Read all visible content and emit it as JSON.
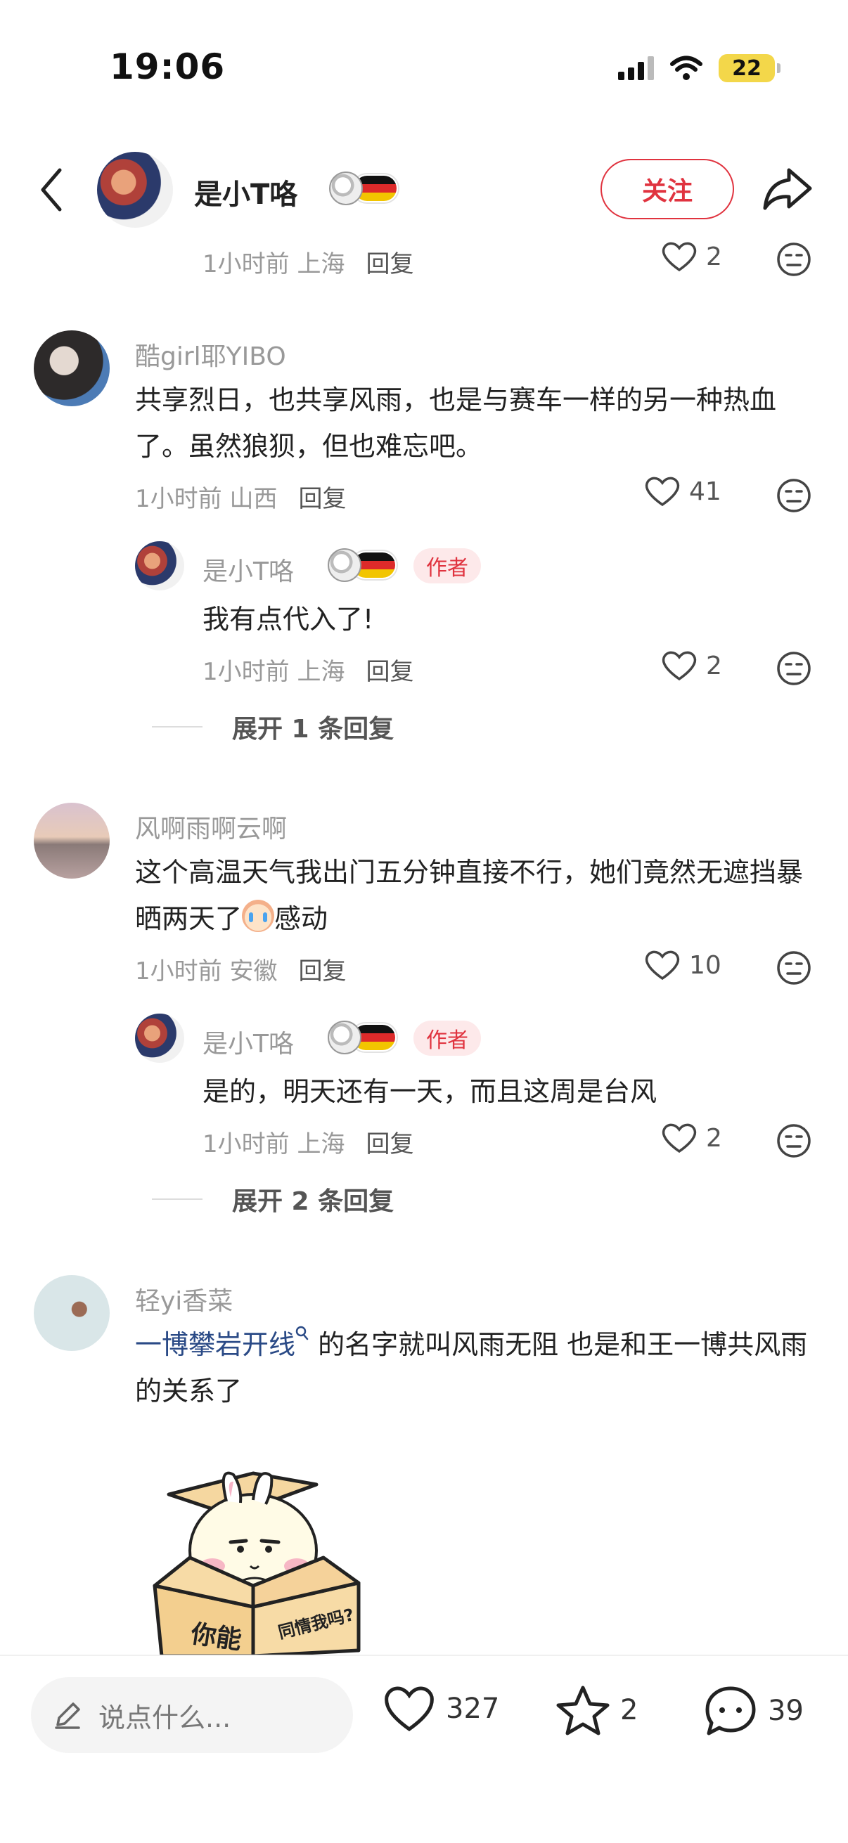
{
  "status_bar": {
    "time": "19:06",
    "battery": "22"
  },
  "header": {
    "author_name": "是小T咯",
    "follow_label": "关注"
  },
  "top_partial_reply": {
    "time": "1小时前",
    "location": "上海",
    "reply_label": "回复",
    "likes": "2"
  },
  "comments": [
    {
      "username": "酷girl耶YIBO",
      "text": "共享烈日，也共享风雨，也是与赛车一样的另一种热血了。虽然狼狈，但也难忘吧。",
      "time": "1小时前",
      "location": "山西",
      "reply_label": "回复",
      "likes": "41",
      "reply": {
        "username": "是小T咯",
        "author_tag": "作者",
        "text": "我有点代入了!",
        "time": "1小时前",
        "location": "上海",
        "reply_label": "回复",
        "likes": "2"
      },
      "expand_label": "展开 1 条回复"
    },
    {
      "username": "风啊雨啊云啊",
      "text_before_emoji": "这个高温天气我出门五分钟直接不行，她们竟然无遮挡暴晒两天了",
      "text_after_emoji": "感动",
      "time": "1小时前",
      "location": "安徽",
      "reply_label": "回复",
      "likes": "10",
      "reply": {
        "username": "是小T咯",
        "author_tag": "作者",
        "text": "是的，明天还有一天，而且这周是台风",
        "time": "1小时前",
        "location": "上海",
        "reply_label": "回复",
        "likes": "2"
      },
      "expand_label": "展开 2 条回复"
    },
    {
      "username": "轻yi香菜",
      "link_text": "一博攀岩开线",
      "text": " 的名字就叫风雨无阻 也是和王一博共风雨的关系了",
      "sticker_text_left": "你能",
      "sticker_text_right": "同情我吗?"
    }
  ],
  "bottom_bar": {
    "input_placeholder": "说点什么...",
    "likes": "327",
    "favorites": "2",
    "comments": "39"
  },
  "colors": {
    "accent": "#e0333f",
    "link": "#2a4a86",
    "muted": "#999999"
  }
}
